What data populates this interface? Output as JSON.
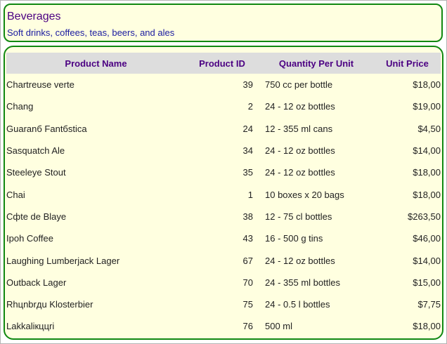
{
  "category": {
    "name": "Beverages",
    "description": "Soft drinks, coffees, teas, beers, and ales"
  },
  "table": {
    "columns": [
      "Product Name",
      "Product ID",
      "Quantity Per Unit",
      "Unit Price"
    ],
    "rows": [
      [
        "Chartreuse verte",
        "39",
        "750 cc per bottle",
        "$18,00"
      ],
      [
        "Chang",
        "2",
        "24 - 12 oz bottles",
        "$19,00"
      ],
      [
        "Guaranб Fantбstica",
        "24",
        "12 - 355 ml cans",
        "$4,50"
      ],
      [
        "Sasquatch Ale",
        "34",
        "24 - 12 oz bottles",
        "$14,00"
      ],
      [
        "Steeleye Stout",
        "35",
        "24 - 12 oz bottles",
        "$18,00"
      ],
      [
        "Chai",
        "1",
        "10 boxes x 20 bags",
        "$18,00"
      ],
      [
        "Cфte de Blaye",
        "38",
        "12 - 75 cl bottles",
        "$263,50"
      ],
      [
        "Ipoh Coffee",
        "43",
        "16 - 500 g tins",
        "$46,00"
      ],
      [
        "Laughing Lumberjack Lager",
        "67",
        "24 - 12 oz bottles",
        "$14,00"
      ],
      [
        "Outback Lager",
        "70",
        "24 - 355 ml bottles",
        "$15,00"
      ],
      [
        "Rhцnbrдu Klosterbier",
        "75",
        "24 - 0.5 l bottles",
        "$7,75"
      ],
      [
        "Lakkaliкццri",
        "76",
        "500 ml",
        "$18,00"
      ]
    ]
  },
  "colors": {
    "panel_background": "#ffffe0",
    "panel_border": "#118811",
    "header_text": "#4b0082",
    "description_text": "#1a1aa0",
    "table_header_background": "#dddddd"
  }
}
